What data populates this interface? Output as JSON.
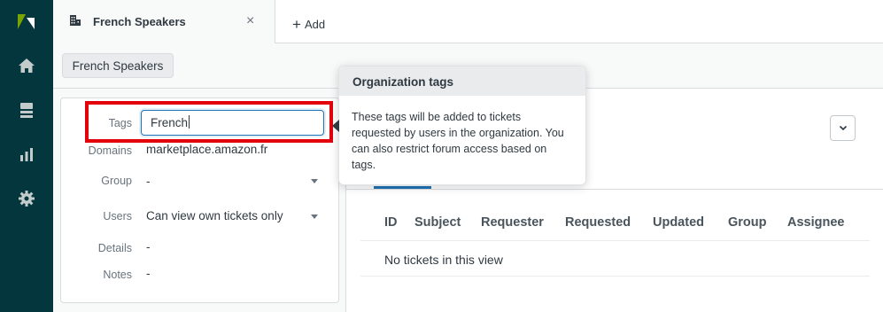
{
  "tab": {
    "title": "French Speakers",
    "close": "×"
  },
  "add": {
    "plus": "+",
    "label": "Add"
  },
  "breadcrumb": {
    "label": "French Speakers"
  },
  "fields": {
    "tags": {
      "label": "Tags",
      "value": "French"
    },
    "domains": {
      "label": "Domains",
      "value": "marketplace.amazon.fr"
    },
    "group": {
      "label": "Group",
      "value": "-"
    },
    "users": {
      "label": "Users",
      "value": "Can view own tickets only"
    },
    "details": {
      "label": "Details",
      "value": "-"
    },
    "notes": {
      "label": "Notes",
      "value": "-"
    }
  },
  "tooltip": {
    "title": "Organization tags",
    "body": "These tags will be added to tickets requested by users in the organization. You can also restrict forum access based on tags."
  },
  "table": {
    "columns": [
      "ID",
      "Subject",
      "Requester",
      "Requested",
      "Updated",
      "Group",
      "Assignee"
    ],
    "empty_text": "No tickets in this view"
  },
  "menu_button": {
    "icon": "chevron-down-icon",
    "glyph": "⌄"
  },
  "nav": {
    "icons": [
      "zendesk-logo-icon",
      "home-icon",
      "views-icon",
      "reporting-icon",
      "settings-icon"
    ]
  },
  "colors": {
    "nav_bg": "#03363d",
    "logo_green": "#78a300",
    "accent_blue": "#1f73b7",
    "highlight_red": "#e3000b"
  }
}
